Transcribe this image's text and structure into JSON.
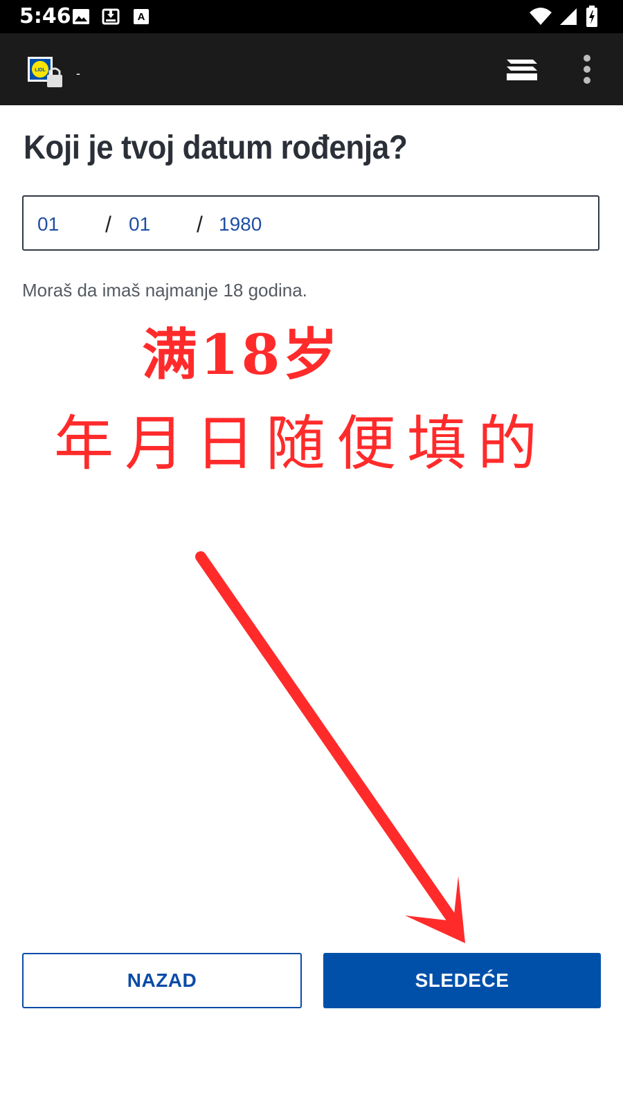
{
  "status_bar": {
    "time": "5:46",
    "icons": [
      "image-icon",
      "download-icon",
      "accessibility-a-icon",
      "wifi-icon",
      "signal-icon",
      "battery-charging-icon"
    ]
  },
  "app_bar": {
    "site_icon": "lidl-logo-lock-icon",
    "url": "-",
    "tabs_icon": "tabs-icon",
    "menu_icon": "more-vert-icon"
  },
  "form": {
    "title": "Koji je tvoj datum rođenja?",
    "day": "01",
    "month": "01",
    "year": "1980",
    "separator": "/",
    "hint": "Moraš da imaš najmanje 18 godina."
  },
  "annotation": {
    "line1": "满18岁",
    "line2": "年月日随便填的",
    "color": "#ff2b2b"
  },
  "buttons": {
    "back_label": "NAZAD",
    "next_label": "SLEDEĆE"
  },
  "colors": {
    "primary": "#0050aa",
    "date_text": "#1f4fa2",
    "toolbar": "#1b1b1b"
  }
}
